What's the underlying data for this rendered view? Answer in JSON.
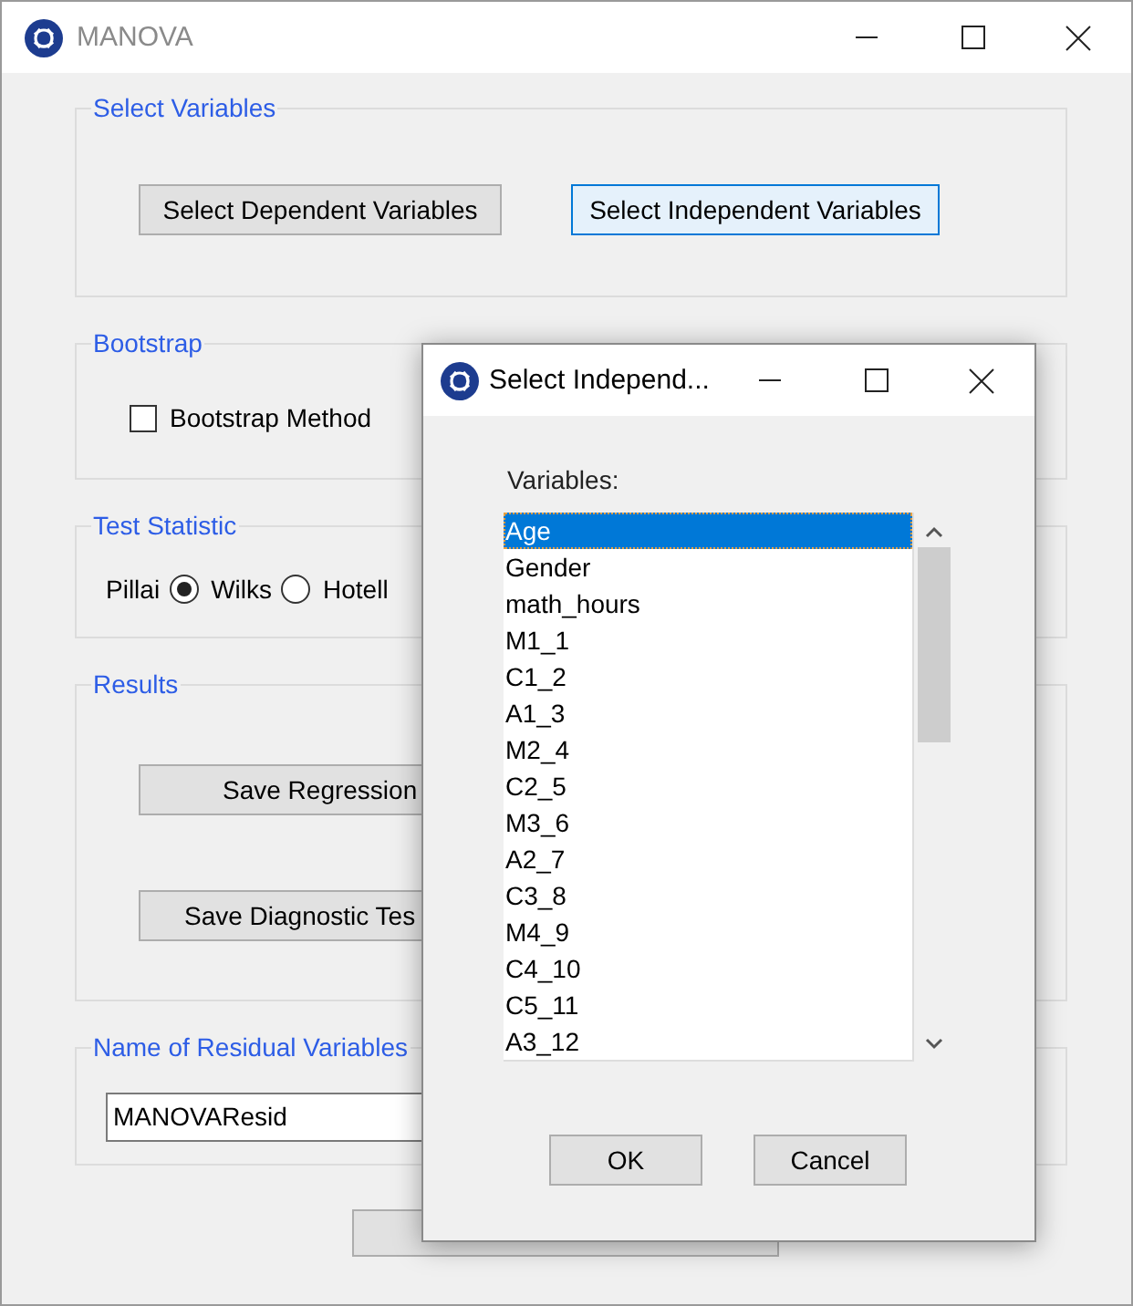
{
  "main_window": {
    "title": "MANOVA",
    "select_variables": {
      "title": "Select Variables",
      "buttons": [
        {
          "label": "Select Dependent Variables",
          "focused": false
        },
        {
          "label": "Select Independent Variables",
          "focused": true
        }
      ]
    },
    "bootstrap": {
      "title": "Bootstrap",
      "checkbox": {
        "label": "Bootstrap Method",
        "checked": false
      }
    },
    "test_statistic": {
      "title": "Test Statistic",
      "options": [
        {
          "label": "Pillai",
          "selected": true
        },
        {
          "label": "Wilks",
          "selected": false
        },
        {
          "label": "Hotell"
        }
      ]
    },
    "results": {
      "title": "Results",
      "buttons": [
        "Save Regression",
        "Save Diagnostic Tes"
      ]
    },
    "residual": {
      "title": "Name of Residual Variables",
      "value": "MANOVAResid"
    }
  },
  "dialog": {
    "title": "Select Independ...",
    "list_label": "Variables:",
    "items": [
      {
        "label": "Age",
        "selected": true
      },
      {
        "label": "Gender",
        "selected": false
      },
      {
        "label": "math_hours",
        "selected": false
      },
      {
        "label": "M1_1",
        "selected": false
      },
      {
        "label": "C1_2",
        "selected": false
      },
      {
        "label": "A1_3",
        "selected": false
      },
      {
        "label": "M2_4",
        "selected": false
      },
      {
        "label": "C2_5",
        "selected": false
      },
      {
        "label": "M3_6",
        "selected": false
      },
      {
        "label": "A2_7",
        "selected": false
      },
      {
        "label": "C3_8",
        "selected": false
      },
      {
        "label": "M4_9",
        "selected": false
      },
      {
        "label": "C4_10",
        "selected": false
      },
      {
        "label": "C5_11",
        "selected": false
      },
      {
        "label": "A3_12",
        "selected": false
      }
    ],
    "buttons": [
      "OK",
      "Cancel"
    ]
  }
}
